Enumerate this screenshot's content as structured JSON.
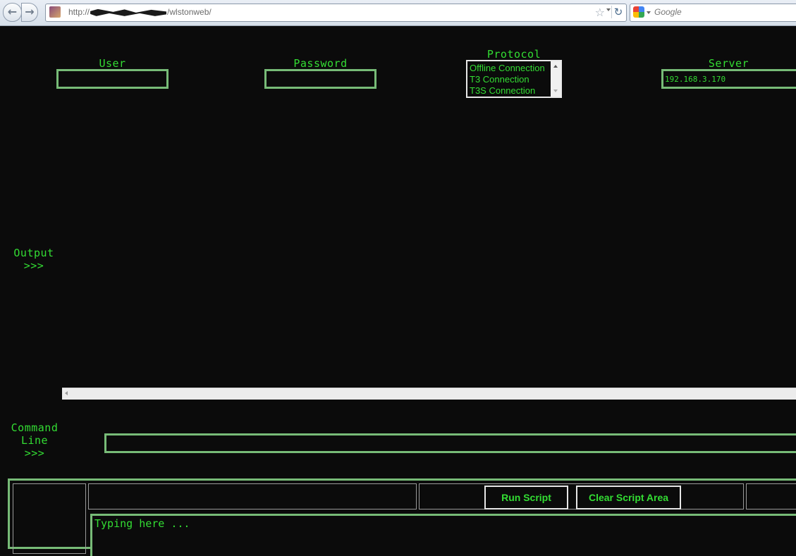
{
  "browser": {
    "url_prefix": "http://",
    "url_suffix": "/wlstonweb/",
    "search_placeholder": "Google"
  },
  "form": {
    "user_label": "User",
    "user_value": "",
    "password_label": "Password",
    "password_value": "",
    "protocol_label": "Protocol",
    "protocol_options": [
      "Offline Connection",
      "T3 Connection",
      "T3S Connection"
    ],
    "server_label": "Server",
    "server_value": "192.168.3.170"
  },
  "output": {
    "label_line1": "Output",
    "label_line2": ">>>"
  },
  "command": {
    "label_line1": "Command",
    "label_line2": "Line",
    "label_line3": ">>>",
    "value": ""
  },
  "script": {
    "run_label": "Run Script",
    "clear_label": "Clear Script Area",
    "placeholder": "Typing here ..."
  },
  "colors": {
    "background": "#0b0b0b",
    "text_green": "#33dd33",
    "border_green": "#77bb77"
  }
}
